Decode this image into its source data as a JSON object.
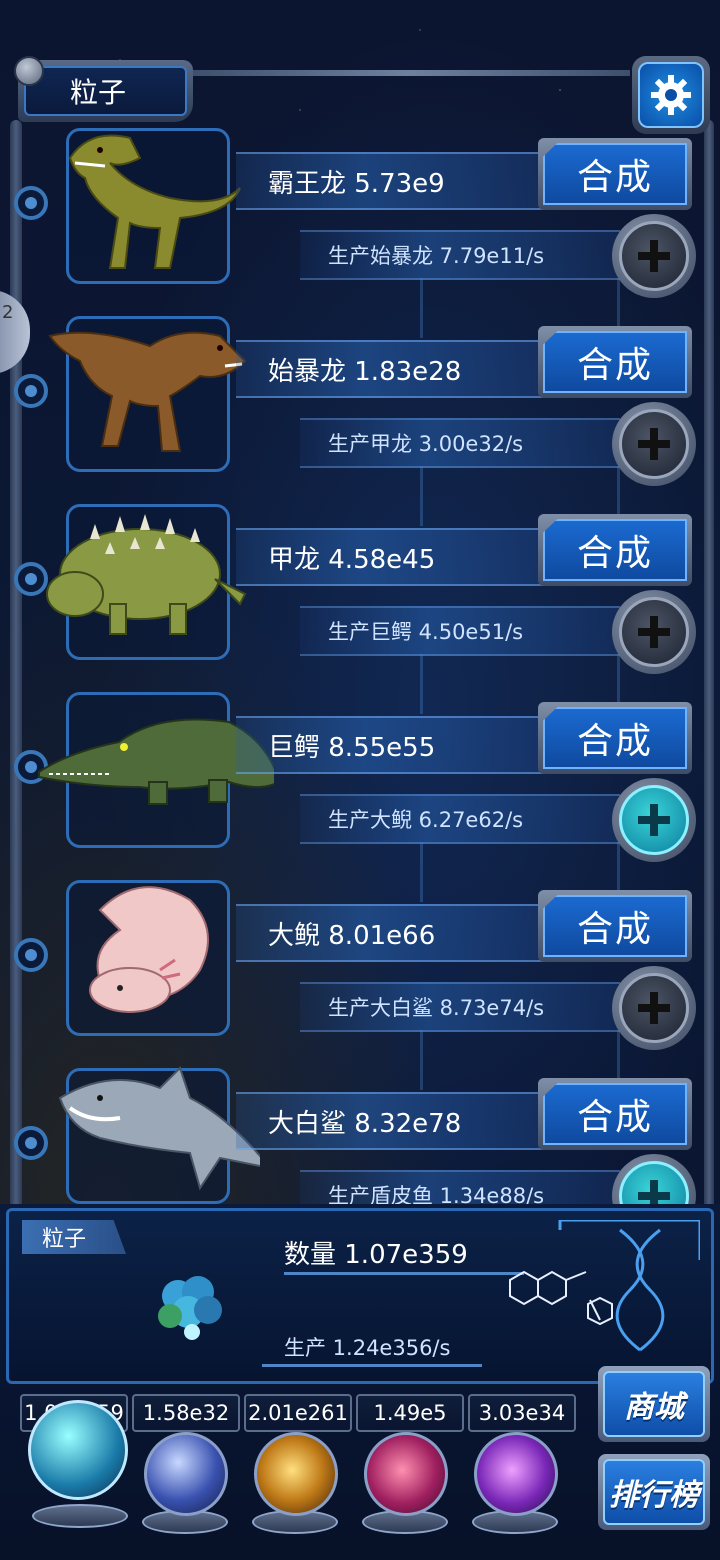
{
  "header": {
    "title": "粒子"
  },
  "creatures": [
    {
      "name": "霸王龙 5.73e9",
      "produce": "生产始暴龙 7.79e11/s",
      "merge_label": "合成",
      "plus_active": false
    },
    {
      "name": "始暴龙 1.83e28",
      "produce": "生产甲龙 3.00e32/s",
      "merge_label": "合成",
      "plus_active": false
    },
    {
      "name": "甲龙 4.58e45",
      "produce": "生产巨鳄 4.50e51/s",
      "merge_label": "合成",
      "plus_active": false
    },
    {
      "name": "巨鳄 8.55e55",
      "produce": "生产大鲵 6.27e62/s",
      "merge_label": "合成",
      "plus_active": true
    },
    {
      "name": "大鲵 8.01e66",
      "produce": "生产大白鲨 8.73e74/s",
      "merge_label": "合成",
      "plus_active": false
    },
    {
      "name": "大白鲨 8.32e78",
      "produce": "生产盾皮鱼 1.34e88/s",
      "merge_label": "合成",
      "plus_active": true
    }
  ],
  "info": {
    "tag": "粒子",
    "quantity": "数量 1.07e359",
    "production": "生产 1.24e356/s"
  },
  "resources": [
    "1.07e359",
    "1.58e32",
    "2.01e261",
    "1.49e5",
    "3.03e34"
  ],
  "side_buttons": {
    "shop": "商城",
    "ranking": "排行榜"
  },
  "edge_badge": "2",
  "colors": {
    "accent": "#1b6ad0",
    "active_plus": "#3ad4d8",
    "background": "#0a1228"
  }
}
